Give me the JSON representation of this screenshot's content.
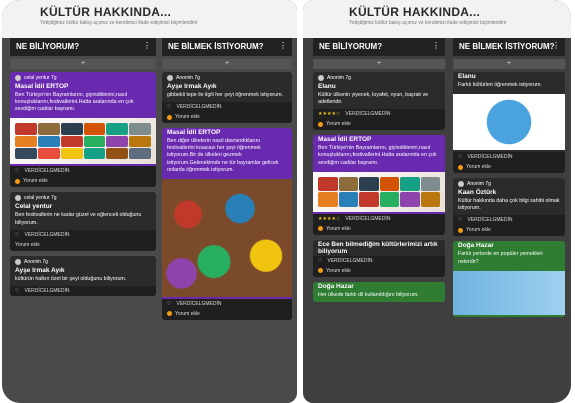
{
  "left": {
    "title": "KÜLTÜR HAKKINDA...",
    "subtitle": "Yetiştiğimiz kültür bakış açımız ve kendimizi ifade edişimizi biçimlendirir",
    "col1": {
      "heading": "NE BİLİYORUM?",
      "cards": [
        {
          "author": "celal yentur 7g",
          "title": "Masal İdil ERTOP",
          "body": "Ben Türkiye'nin Bayramlarını, giyindiklerini,nasıl konuştuklarını,festivallerini.Hatta aralarında en çok sevdiğim cadılar bayramı.",
          "foot": "VERDİCELGMEDİN",
          "comment": "Yorum ekle"
        },
        {
          "author": "",
          "title": "Celal yentur",
          "body": "Ben festivallerin ne kadar güzel ve eğlenceli olduğunu biliyorum.",
          "foot": "VERDİCELGMEDİN",
          "comment": "Yorum ekle"
        },
        {
          "author": "",
          "title": "Ayşe Irmak Ayık",
          "body": "kültürün halkın özel bir şeyi olduğunu biliyorum.",
          "foot": "VERDİCELGMEDİN",
          "comment": ""
        }
      ]
    },
    "col2": {
      "heading": "NE BİLMEK İSTİYORUM?",
      "cards": [
        {
          "author": "Anonim 7g",
          "title": "Ayşe Irmak Ayık",
          "body": "gibbekli tepe ile ilgili her şeyi öğrenmek istiyorum.",
          "foot": "VERDİCELGMEDİN",
          "comment": "Yorum ekle"
        },
        {
          "author": "",
          "title": "Masal İdil ERTOP",
          "body": "Ben diğer ülkelerin nasıl davrandıklarını festivallerini kısacası her şeyi öğrenmek istiyorum.Bir de ülkeleri gezmek istiyorum.Gelecekimde ne tür bayramlar gelicek onlarda öğrenmek istiyorum.",
          "foot": "VERDİCELGMEDİN",
          "comment": "Yorum ekle"
        }
      ]
    }
  },
  "right": {
    "title": "KÜLTÜR HAKKINDA...",
    "subtitle": "Yetiştiğimiz kültür bakış açımız ve kendimizi ifade edişimizi biçimlendirir",
    "col1": {
      "heading": "NE BİLİYORUM?",
      "cards": [
        {
          "author": "Anonim 7g",
          "title": "Elanu",
          "body": "Kültür ülkenin yiyecek, kıyafet, oyun, başrak ve adetleridir.",
          "foot": "VERDİCELGMEDİN",
          "comment": "Yorum ekle"
        },
        {
          "author": "",
          "title": "Masal İdil ERTOP",
          "body": "Ben Türkiye'nin Bayramlarını, giyindiklerini,nasıl konuştuklarını,festivallerini.Hatta aralarında en çok sevdiğim cadılar bayramı.",
          "foot": "VERDİCELGMEDİN",
          "comment": "Yorum ekle"
        },
        {
          "author": "",
          "title": "Ece Ben bilmediğim kültürlerimizi artık biliyorum",
          "body": "",
          "foot": "VERDİCELGMEDİN",
          "comment": "Yorum ekle"
        },
        {
          "author": "",
          "title": "Doğa Hazar",
          "body": "Her ülkede farklı dil kullanıldığını biliyorum.",
          "foot": "",
          "comment": ""
        }
      ]
    },
    "col2": {
      "heading": "NE BİLMEK İSTİYORUM?",
      "cards": [
        {
          "author": "",
          "title": "Elanu",
          "body": "Farklı kültürleri öğrenmek istiyorum.",
          "foot": "VERDİCELGMEDİN",
          "comment": "Yorum ekle"
        },
        {
          "author": "Anonim 7g",
          "title": "Kaan Öztürk",
          "body": "Kültür hakkında daha çok bilgi sahibi olmak istiyorum.",
          "foot": "VERDİCELGMEDİN",
          "comment": "Yorum ekle"
        },
        {
          "author": "",
          "title": "Doğa Hazar",
          "body": "Farklı yerlerde en popüler yemekleri nelerdir?",
          "foot": "",
          "comment": ""
        }
      ]
    }
  }
}
